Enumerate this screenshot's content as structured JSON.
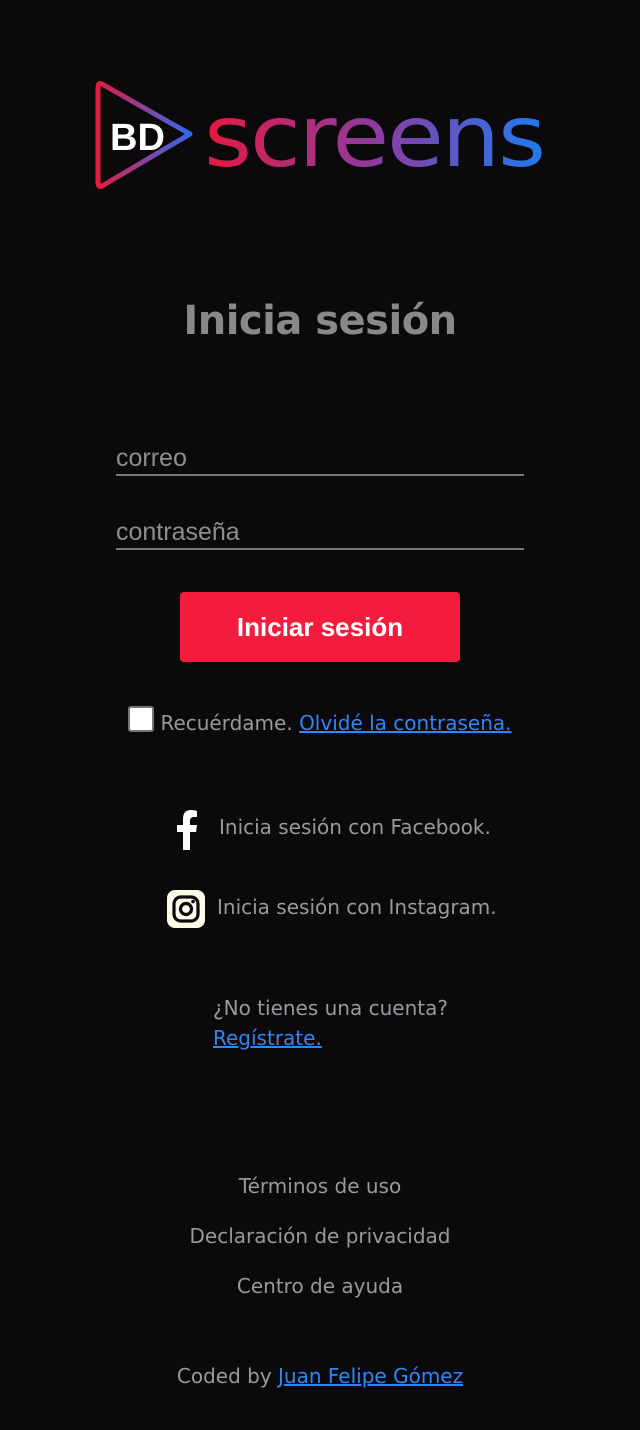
{
  "brand": {
    "logo_mark_text": "BD",
    "logo_word_text": "screens",
    "gradient": [
      "#e5193f",
      "#8e3b9f",
      "#1f7bf0"
    ]
  },
  "login": {
    "title": "Inicia sesión",
    "email_placeholder": "correo",
    "password_placeholder": "contraseña",
    "submit_label": "Iniciar sesión",
    "remember_label": "Recuérdame.",
    "forgot_label": "Olvidé la contraseña."
  },
  "social": [
    {
      "label": "Inicia sesión con Facebook.",
      "icon": "facebook-icon"
    },
    {
      "label": "Inicia sesión con Instagram.",
      "icon": "instagram-icon"
    }
  ],
  "signup": {
    "prompt": "¿No tienes una cuenta?",
    "link_label": "Regístrate."
  },
  "footer": {
    "links": [
      "Términos de uso",
      "Declaración de privacidad",
      "Centro de ayuda"
    ],
    "coded_by_prefix": "Coded by",
    "author_link": "Juan Felipe Gómez"
  },
  "colors": {
    "background": "#0b090c",
    "accent": "#f41c3c",
    "link": "#2f86f6"
  }
}
